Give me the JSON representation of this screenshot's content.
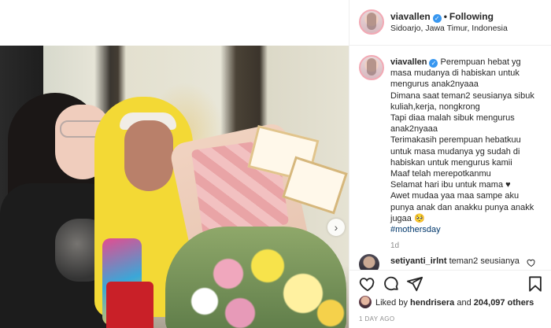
{
  "post": {
    "username": "viavallen",
    "following_label": "Following",
    "location": "Sidoarjo, Jawa Timur, Indonesia"
  },
  "caption": {
    "username": "viavallen",
    "lines": [
      "Perempuan hebat yg",
      "masa mudanya di habiskan untuk",
      "mengurus anak2nyaaa",
      "Dimana saat teman2 seusianya sibuk",
      "kuliah,kerja, nongkrong",
      "Tapi diaa malah sibuk mengurus",
      "anak2nyaaa",
      "Terimakasih perempuan hebatkuu",
      "untuk masa mudanya yg sudah di",
      "habiskan untuk mengurus kamii",
      "Maaf telah merepotkanmu",
      "Selamat hari ibu untuk mama ♥",
      "Awet mudaa yaa maa sampe aku",
      "punya anak dan anakku punya anakk",
      "jugaa 🥺"
    ],
    "hashtag": "#mothersday",
    "age": "1d"
  },
  "comment": {
    "username": "setiyanti_irlnt",
    "text": "teman2 seusianya"
  },
  "actions": {
    "icons": [
      "heart-icon",
      "comment-icon",
      "share-icon",
      "bookmark-icon"
    ]
  },
  "likes": {
    "prefix": "Liked by",
    "user": "hendrisera",
    "middle": "and",
    "count": "204,097 others"
  },
  "date": "1 DAY AGO",
  "colors": {
    "link": "#00376b",
    "verified": "#3897f0",
    "muted": "#8e8e8e"
  }
}
